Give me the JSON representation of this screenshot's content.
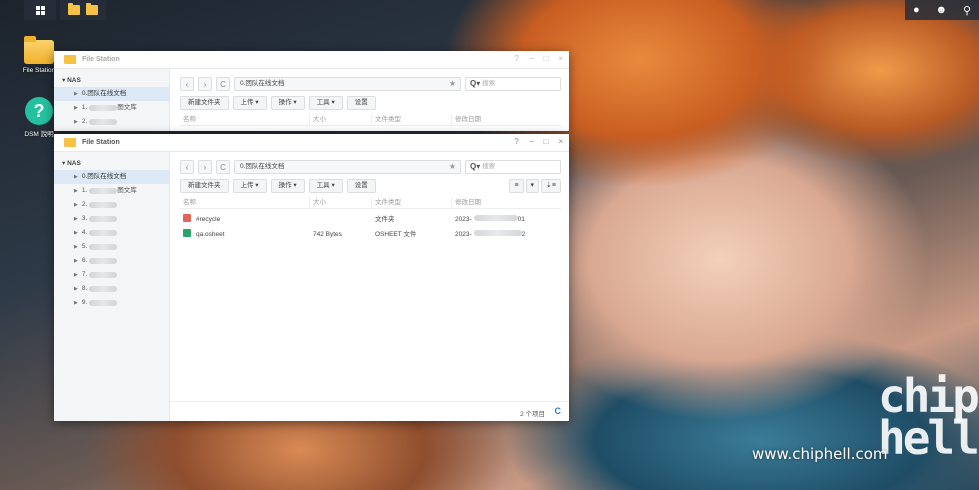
{
  "taskbar": {
    "main_menu_icon": "grid-icon",
    "open_apps": [
      "File Station",
      "File Station"
    ],
    "right_icons": [
      "chat-icon",
      "user-icon",
      "search-icon"
    ]
  },
  "desktop": {
    "icons": [
      {
        "label": "File Station",
        "icon": "folder-icon"
      },
      {
        "label": "DSM 說明",
        "icon": "help-icon"
      }
    ]
  },
  "window_back": {
    "title": "File Station",
    "controls": [
      "?",
      "−",
      "□",
      "×"
    ],
    "tree_root": "NAS",
    "tree_items": [
      "0.团队在线文档",
      "1.",
      "2."
    ],
    "tree_items_suffix": [
      "",
      "图文库",
      ""
    ],
    "path": "0.团队在线文档",
    "search_placeholder": "搜索",
    "toolbar": [
      "新建文件夹",
      "上传 ▾",
      "操作 ▾",
      "工具 ▾",
      "设置"
    ],
    "columns": [
      "名称",
      "大小",
      "文件类型",
      "修改日期"
    ]
  },
  "window_front": {
    "title": "File Station",
    "controls": [
      "?",
      "−",
      "□",
      "×"
    ],
    "tree_root": "NAS",
    "tree_items": [
      "0.团队在线文档",
      "1.",
      "2.",
      "3.",
      "4.",
      "5.",
      "6.",
      "7.",
      "8.",
      "9."
    ],
    "tree_items_suffix": [
      "",
      "图文库",
      "",
      "",
      "",
      "",
      "",
      "",
      "",
      ""
    ],
    "path": "0.团队在线文档",
    "search_placeholder": "搜索",
    "toolbar": [
      "新建文件夹",
      "上传 ▾",
      "操作 ▾",
      "工具 ▾",
      "设置"
    ],
    "view_buttons": [
      "≡",
      "▾",
      "⇣≡"
    ],
    "columns": [
      "名称",
      "大小",
      "文件类型",
      "修改日期"
    ],
    "rows": [
      {
        "name": "#recycle",
        "size": "",
        "type": "文件夹",
        "date_prefix": "2023-",
        "date_suffix": "01",
        "icon": "recycle-icon"
      },
      {
        "name": "qa.osheet",
        "size": "742 Bytes",
        "type": "OSHEET 文件",
        "date_prefix": "2023-",
        "date_suffix": "2",
        "icon": "sheet-file-icon"
      }
    ],
    "status_count": "2 个项目"
  },
  "watermark": {
    "url": "www.chiphell.com",
    "logo_text": "chip hell"
  }
}
